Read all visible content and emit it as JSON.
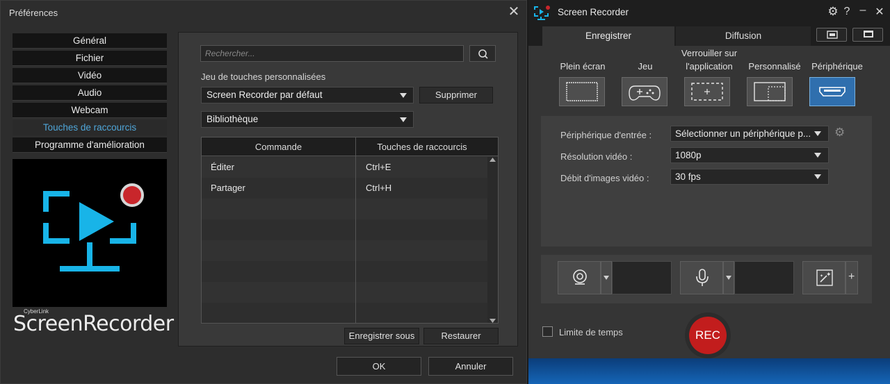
{
  "prefs": {
    "title": "Préférences",
    "nav": [
      "Général",
      "Fichier",
      "Vidéo",
      "Audio",
      "Webcam",
      "Touches de raccourcis",
      "Programme d'amélioration"
    ],
    "active_nav": "Touches de raccourcis",
    "brand_small": "CyberLink",
    "brand": "ScreenRecorder",
    "search_placeholder": "Rechercher...",
    "hotkey_set_label": "Jeu de touches personnalisées",
    "hotkey_set_value": "Screen Recorder par défaut",
    "delete_label": "Supprimer",
    "category_value": "Bibliothèque",
    "table": {
      "headers": [
        "Commande",
        "Touches de raccourcis"
      ],
      "rows": [
        {
          "command": "Éditer",
          "keys": "Ctrl+E"
        },
        {
          "command": "Partager",
          "keys": "Ctrl+H"
        }
      ]
    },
    "save_as_label": "Enregistrer sous",
    "restore_label": "Restaurer",
    "ok_label": "OK",
    "cancel_label": "Annuler"
  },
  "recorder": {
    "title": "Screen Recorder",
    "tabs": [
      "Enregistrer",
      "Diffusion"
    ],
    "modes": [
      {
        "label": "Plein écran"
      },
      {
        "label": "Jeu"
      },
      {
        "label": "Verrouiller sur l'application"
      },
      {
        "label": "Personnalisé"
      },
      {
        "label": "Périphérique"
      }
    ],
    "settings": {
      "input_label": "Périphérique d'entrée :",
      "input_value": "Sélectionner un périphérique p...",
      "resolution_label": "Résolution vidéo :",
      "resolution_value": "1080p",
      "framerate_label": "Débit d'images vidéo :",
      "framerate_value": "30 fps"
    },
    "time_limit_label": "Limite de temps",
    "rec_label": "REC",
    "colors": {
      "accent": "#4fa6d9",
      "rec": "#c21d1d",
      "active_mode": "#2f6fae"
    }
  }
}
